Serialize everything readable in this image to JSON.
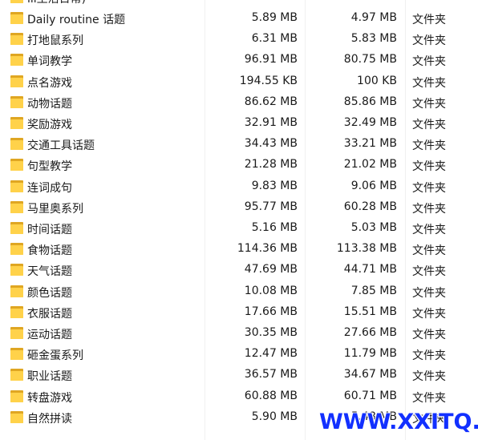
{
  "type_label": "文件夹",
  "partial_row_name": "iii生活日常)",
  "rows": [
    {
      "name": "Daily routine 话题",
      "size": "5.89 MB",
      "packed": "4.97 MB"
    },
    {
      "name": "打地鼠系列",
      "size": "6.31 MB",
      "packed": "5.83 MB"
    },
    {
      "name": "单词教学",
      "size": "96.91 MB",
      "packed": "80.75 MB"
    },
    {
      "name": "点名游戏",
      "size": "194.55 KB",
      "packed": "100 KB"
    },
    {
      "name": "动物话题",
      "size": "86.62 MB",
      "packed": "85.86 MB"
    },
    {
      "name": "奖励游戏",
      "size": "32.91 MB",
      "packed": "32.49 MB"
    },
    {
      "name": "交通工具话题",
      "size": "34.43 MB",
      "packed": "33.21 MB"
    },
    {
      "name": "句型教学",
      "size": "21.28 MB",
      "packed": "21.02 MB"
    },
    {
      "name": "连词成句",
      "size": "9.83 MB",
      "packed": "9.06 MB"
    },
    {
      "name": "马里奥系列",
      "size": "95.77 MB",
      "packed": "60.28 MB"
    },
    {
      "name": "时间话题",
      "size": "5.16 MB",
      "packed": "5.03 MB"
    },
    {
      "name": "食物话题",
      "size": "114.36 MB",
      "packed": "113.38 MB"
    },
    {
      "name": "天气话题",
      "size": "47.69 MB",
      "packed": "44.71 MB"
    },
    {
      "name": "颜色话题",
      "size": "10.08 MB",
      "packed": "7.85 MB"
    },
    {
      "name": "衣服话题",
      "size": "17.66 MB",
      "packed": "15.51 MB"
    },
    {
      "name": "运动话题",
      "size": "30.35 MB",
      "packed": "27.66 MB"
    },
    {
      "name": "砸金蛋系列",
      "size": "12.47 MB",
      "packed": "11.79 MB"
    },
    {
      "name": "职业话题",
      "size": "36.57 MB",
      "packed": "34.67 MB"
    },
    {
      "name": "转盘游戏",
      "size": "60.88 MB",
      "packed": "60.71 MB"
    },
    {
      "name": "自然拼读",
      "size": "5.90 MB",
      "packed": "5.48 MB"
    }
  ],
  "watermark": "WWW.XXITQ.COM",
  "colors": {
    "folder_front": "#ffd24a",
    "folder_back": "#dfa622",
    "watermark": "#1230ff"
  }
}
